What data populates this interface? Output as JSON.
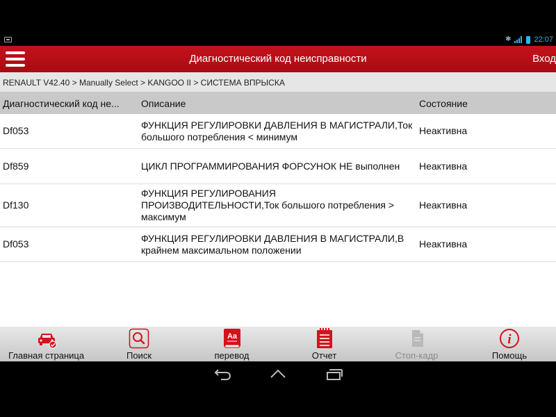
{
  "status_bar": {
    "time": "22:07",
    "bt_glyph": "✱"
  },
  "header": {
    "title": "Диагностический код неисправности",
    "login_label": "Вход"
  },
  "breadcrumb": "RENAULT V42.40 > Manually Select > KANGOO II > СИСТЕМА ВПРЫСКА",
  "table": {
    "columns": [
      "Диагностический код не...",
      "Описание",
      "Состояние"
    ],
    "rows": [
      {
        "code": "Df053",
        "description": "ФУНКЦИЯ РЕГУЛИРОВКИ ДАВЛЕНИЯ В МАГИСТРАЛИ,Ток большого потребления < минимум",
        "status": "Неактивна"
      },
      {
        "code": "Df859",
        "description": "ЦИКЛ ПРОГРАММИРОВАНИЯ ФОРСУНОК НЕ выполнен",
        "status": "Неактивна"
      },
      {
        "code": "Df130",
        "description": "ФУНКЦИЯ РЕГУЛИРОВАНИЯ ПРОИЗВОДИТЕЛЬНОСТИ,Ток большого потребления > максимум",
        "status": "Неактивна"
      },
      {
        "code": "Df053",
        "description": "ФУНКЦИЯ РЕГУЛИРОВКИ ДАВЛЕНИЯ В МАГИСТРАЛИ,В крайнем максимальном положении",
        "status": "Неактивна"
      }
    ]
  },
  "toolbar": {
    "home_label": "Главная страница",
    "search_label": "Поиск",
    "translate_label": "перевод",
    "translate_icon_text": "Aa",
    "report_label": "Отчет",
    "freeze_label": "Стоп-кадр",
    "help_label": "Помощь",
    "help_icon_text": "i"
  },
  "colors": {
    "header": "#b50f17",
    "accent_red": "#d3121c",
    "status_blue": "#33b5e5",
    "disabled": "#8a8a8a"
  },
  "icons": {
    "home": "car-icon",
    "search": "search-icon",
    "translate": "dictionary-icon",
    "report": "report-icon",
    "freeze": "document-icon",
    "help": "info-icon",
    "nav": [
      "back-icon",
      "home-icon",
      "recent-apps-icon"
    ]
  }
}
